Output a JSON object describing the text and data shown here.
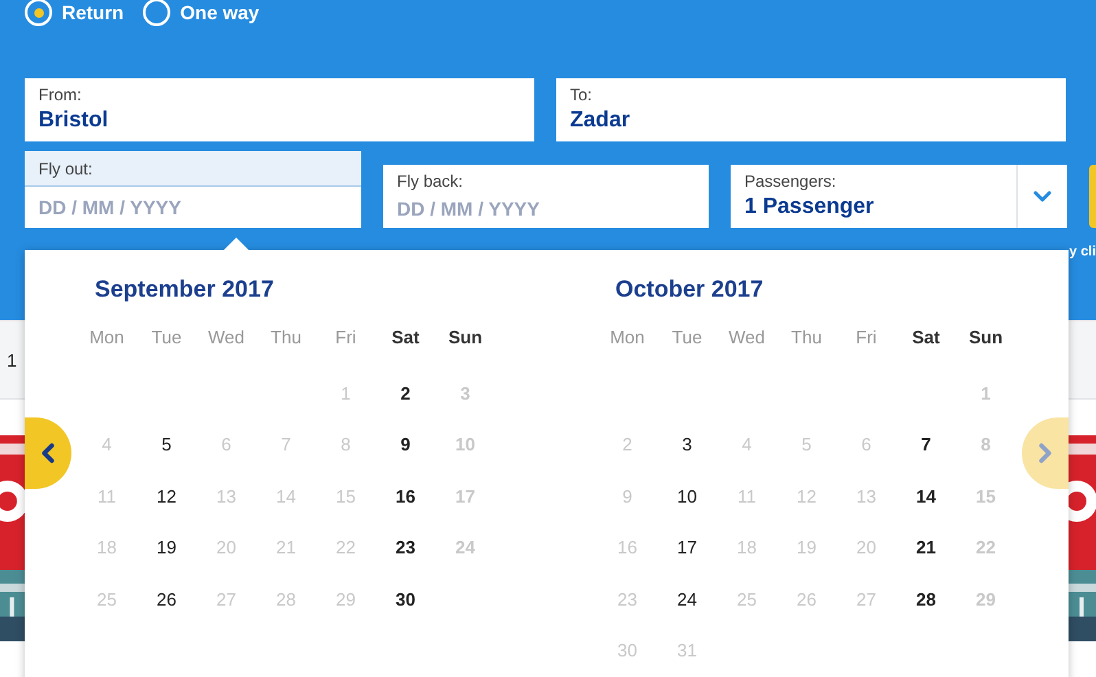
{
  "trip_type": [
    {
      "label": "Return",
      "selected": true
    },
    {
      "label": "One way",
      "selected": false
    }
  ],
  "fields": [
    {
      "kind": "text",
      "label": "From:",
      "value": "Bristol"
    },
    {
      "kind": "text",
      "label": "To:",
      "value": "Zadar"
    },
    {
      "kind": "date",
      "label": "Fly out:",
      "placeholder": "DD / MM / YYYY",
      "active": true
    },
    {
      "kind": "date",
      "label": "Fly back:",
      "placeholder": "DD / MM / YYYY",
      "active": false
    },
    {
      "kind": "select",
      "label": "Passengers:",
      "value": "1 Passenger"
    }
  ],
  "side_note": "y cli",
  "left_row_text": "1",
  "calendar": {
    "prev": {
      "disabled": false
    },
    "next": {
      "disabled": true
    },
    "months": [
      {
        "title": "September 2017",
        "weekdays": [
          {
            "label": "Mon",
            "weekend": false
          },
          {
            "label": "Tue",
            "weekend": false
          },
          {
            "label": "Wed",
            "weekend": false
          },
          {
            "label": "Thu",
            "weekend": false
          },
          {
            "label": "Fri",
            "weekend": false
          },
          {
            "label": "Sat",
            "weekend": true
          },
          {
            "label": "Sun",
            "weekend": true
          }
        ],
        "weeks": [
          [
            {
              "kind": "blank"
            },
            {
              "kind": "blank"
            },
            {
              "kind": "blank"
            },
            {
              "kind": "blank"
            },
            {
              "kind": "day",
              "label": "1",
              "available": false
            },
            {
              "kind": "day",
              "label": "2",
              "available": true
            },
            {
              "kind": "day",
              "label": "3",
              "available": false
            }
          ],
          [
            {
              "kind": "day",
              "label": "4",
              "available": false
            },
            {
              "kind": "day",
              "label": "5",
              "available": true
            },
            {
              "kind": "day",
              "label": "6",
              "available": false
            },
            {
              "kind": "day",
              "label": "7",
              "available": false
            },
            {
              "kind": "day",
              "label": "8",
              "available": false
            },
            {
              "kind": "day",
              "label": "9",
              "available": true
            },
            {
              "kind": "day",
              "label": "10",
              "available": false
            }
          ],
          [
            {
              "kind": "day",
              "label": "11",
              "available": false
            },
            {
              "kind": "day",
              "label": "12",
              "available": true
            },
            {
              "kind": "day",
              "label": "13",
              "available": false
            },
            {
              "kind": "day",
              "label": "14",
              "available": false
            },
            {
              "kind": "day",
              "label": "15",
              "available": false
            },
            {
              "kind": "day",
              "label": "16",
              "available": true
            },
            {
              "kind": "day",
              "label": "17",
              "available": false
            }
          ],
          [
            {
              "kind": "day",
              "label": "18",
              "available": false
            },
            {
              "kind": "day",
              "label": "19",
              "available": true
            },
            {
              "kind": "day",
              "label": "20",
              "available": false
            },
            {
              "kind": "day",
              "label": "21",
              "available": false
            },
            {
              "kind": "day",
              "label": "22",
              "available": false
            },
            {
              "kind": "day",
              "label": "23",
              "available": true
            },
            {
              "kind": "day",
              "label": "24",
              "available": false
            }
          ],
          [
            {
              "kind": "day",
              "label": "25",
              "available": false
            },
            {
              "kind": "day",
              "label": "26",
              "available": true
            },
            {
              "kind": "day",
              "label": "27",
              "available": false
            },
            {
              "kind": "day",
              "label": "28",
              "available": false
            },
            {
              "kind": "day",
              "label": "29",
              "available": false
            },
            {
              "kind": "day",
              "label": "30",
              "available": true
            },
            {
              "kind": "blank"
            }
          ]
        ]
      },
      {
        "title": "October 2017",
        "weekdays": [
          {
            "label": "Mon",
            "weekend": false
          },
          {
            "label": "Tue",
            "weekend": false
          },
          {
            "label": "Wed",
            "weekend": false
          },
          {
            "label": "Thu",
            "weekend": false
          },
          {
            "label": "Fri",
            "weekend": false
          },
          {
            "label": "Sat",
            "weekend": true
          },
          {
            "label": "Sun",
            "weekend": true
          }
        ],
        "weeks": [
          [
            {
              "kind": "blank"
            },
            {
              "kind": "blank"
            },
            {
              "kind": "blank"
            },
            {
              "kind": "blank"
            },
            {
              "kind": "blank"
            },
            {
              "kind": "blank"
            },
            {
              "kind": "day",
              "label": "1",
              "available": false
            }
          ],
          [
            {
              "kind": "day",
              "label": "2",
              "available": false
            },
            {
              "kind": "day",
              "label": "3",
              "available": true
            },
            {
              "kind": "day",
              "label": "4",
              "available": false
            },
            {
              "kind": "day",
              "label": "5",
              "available": false
            },
            {
              "kind": "day",
              "label": "6",
              "available": false
            },
            {
              "kind": "day",
              "label": "7",
              "available": true
            },
            {
              "kind": "day",
              "label": "8",
              "available": false
            }
          ],
          [
            {
              "kind": "day",
              "label": "9",
              "available": false
            },
            {
              "kind": "day",
              "label": "10",
              "available": true
            },
            {
              "kind": "day",
              "label": "11",
              "available": false
            },
            {
              "kind": "day",
              "label": "12",
              "available": false
            },
            {
              "kind": "day",
              "label": "13",
              "available": false
            },
            {
              "kind": "day",
              "label": "14",
              "available": true
            },
            {
              "kind": "day",
              "label": "15",
              "available": false
            }
          ],
          [
            {
              "kind": "day",
              "label": "16",
              "available": false
            },
            {
              "kind": "day",
              "label": "17",
              "available": true
            },
            {
              "kind": "day",
              "label": "18",
              "available": false
            },
            {
              "kind": "day",
              "label": "19",
              "available": false
            },
            {
              "kind": "day",
              "label": "20",
              "available": false
            },
            {
              "kind": "day",
              "label": "21",
              "available": true
            },
            {
              "kind": "day",
              "label": "22",
              "available": false
            }
          ],
          [
            {
              "kind": "day",
              "label": "23",
              "available": false
            },
            {
              "kind": "day",
              "label": "24",
              "available": true
            },
            {
              "kind": "day",
              "label": "25",
              "available": false
            },
            {
              "kind": "day",
              "label": "26",
              "available": false
            },
            {
              "kind": "day",
              "label": "27",
              "available": false
            },
            {
              "kind": "day",
              "label": "28",
              "available": true
            },
            {
              "kind": "day",
              "label": "29",
              "available": false
            }
          ],
          [
            {
              "kind": "day",
              "label": "30",
              "available": false
            },
            {
              "kind": "day",
              "label": "31",
              "available": false
            },
            {
              "kind": "blank"
            },
            {
              "kind": "blank"
            },
            {
              "kind": "blank"
            },
            {
              "kind": "blank"
            },
            {
              "kind": "blank"
            }
          ]
        ]
      }
    ]
  }
}
